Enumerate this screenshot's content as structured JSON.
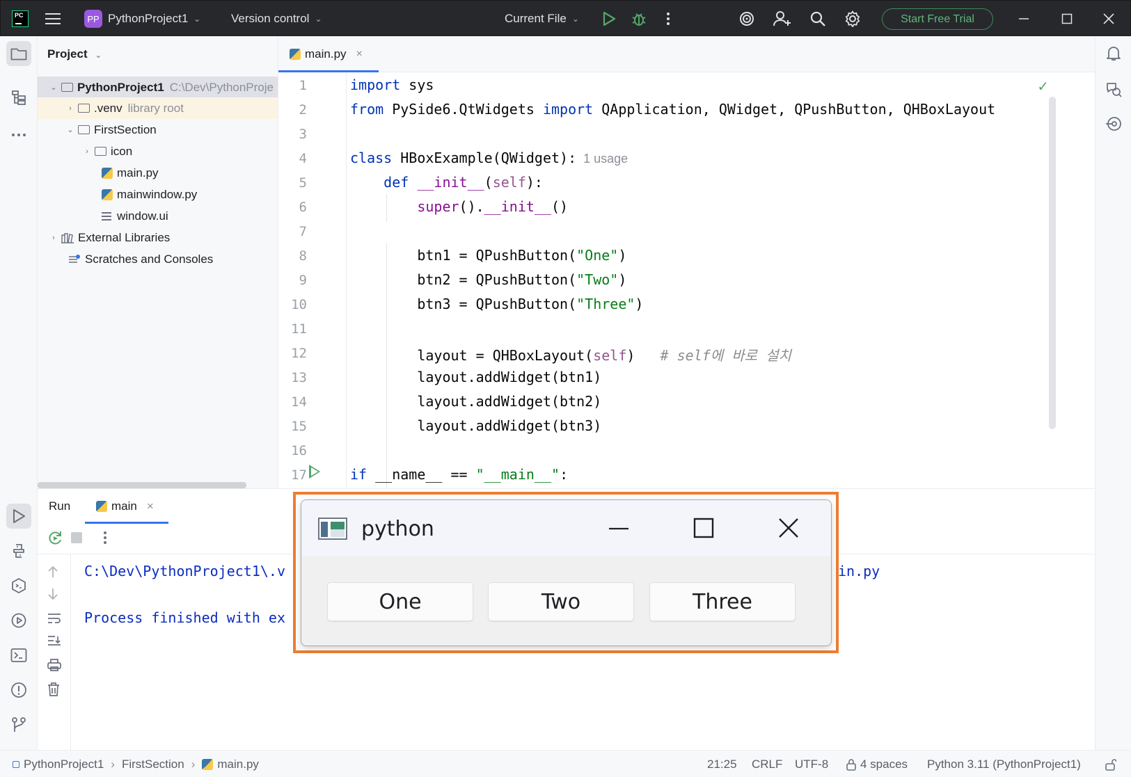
{
  "titlebar": {
    "project_badge": "PP",
    "project_name": "PythonProject1",
    "vcs": "Version control",
    "run_config": "Current File",
    "trial_button": "Start Free Trial"
  },
  "project_panel": {
    "title": "Project",
    "tree": [
      {
        "label": "PythonProject1",
        "extra": "C:\\Dev\\PythonProje",
        "type": "folder",
        "bold": true
      },
      {
        "label": ".venv",
        "extra": "library root",
        "type": "folder"
      },
      {
        "label": "FirstSection",
        "type": "folder"
      },
      {
        "label": "icon",
        "type": "folder"
      },
      {
        "label": "main.py",
        "type": "python"
      },
      {
        "label": "mainwindow.py",
        "type": "python"
      },
      {
        "label": "window.ui",
        "type": "text"
      },
      {
        "label": "External Libraries",
        "type": "library"
      },
      {
        "label": "Scratches and Consoles",
        "type": "scratch"
      }
    ]
  },
  "editor": {
    "tab": "main.py",
    "usage_hint": "1 usage",
    "line_numbers": [
      "1",
      "2",
      "3",
      "4",
      "5",
      "6",
      "7",
      "8",
      "9",
      "10",
      "11",
      "12",
      "13",
      "14",
      "15",
      "16",
      "17"
    ]
  },
  "run_panel": {
    "title": "Run",
    "tab": "main",
    "console_line1": "C:\\Dev\\PythonProject1\\.v",
    "console_line1_tail": "in.py",
    "console_line2": "Process finished with ex"
  },
  "qt_window": {
    "title": "python",
    "buttons": [
      "One",
      "Two",
      "Three"
    ]
  },
  "statusbar": {
    "crumb_project": "PythonProject1",
    "crumb_folder": "FirstSection",
    "crumb_file": "main.py",
    "position": "21:25",
    "line_ending": "CRLF",
    "encoding": "UTF-8",
    "indent": "4 spaces",
    "interpreter": "Python 3.11 (PythonProject1)"
  },
  "colors": {
    "accent": "#3574f0",
    "highlight_frame": "#ed7d31",
    "trial_green": "#5fb87a",
    "run_green": "#55a76a"
  }
}
